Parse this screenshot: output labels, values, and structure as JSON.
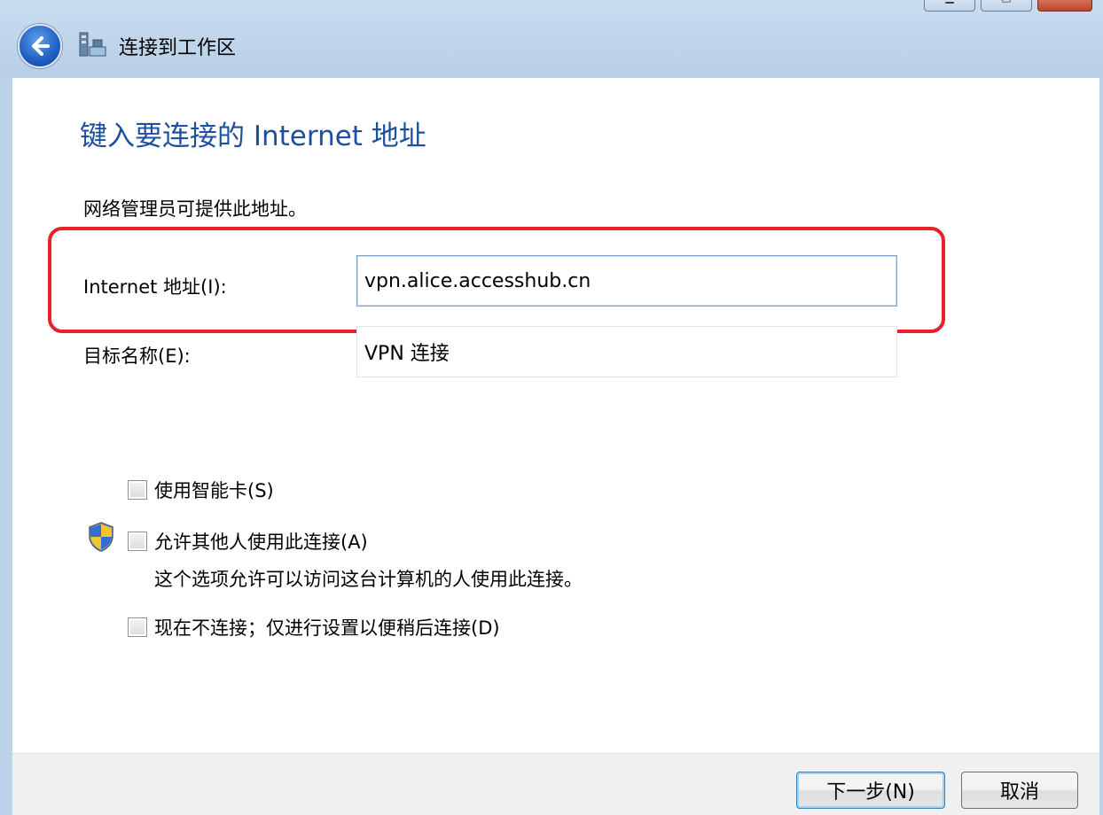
{
  "window": {
    "title": "连接到工作区"
  },
  "content": {
    "heading": "键入要连接的 Internet 地址",
    "description": "网络管理员可提供此地址。",
    "address_label": "Internet 地址(I):",
    "address_value": "vpn.alice.accesshub.cn",
    "target_label": "目标名称(E):",
    "target_value": "VPN 连接"
  },
  "options": {
    "smart_card": {
      "label": "使用智能卡(S)",
      "checked": false
    },
    "allow_others": {
      "label": "允许其他人使用此连接(A)",
      "checked": false,
      "note": "这个选项允许可以访问这台计算机的人使用此连接。"
    },
    "dont_connect": {
      "label": "现在不连接；仅进行设置以便稍后连接(D)",
      "checked": false
    }
  },
  "buttons": {
    "next": "下一步(N)",
    "cancel": "取消"
  },
  "colors": {
    "heading": "#1e4f9e",
    "highlight": "#e8202a",
    "frame": "#bcd3ea"
  }
}
